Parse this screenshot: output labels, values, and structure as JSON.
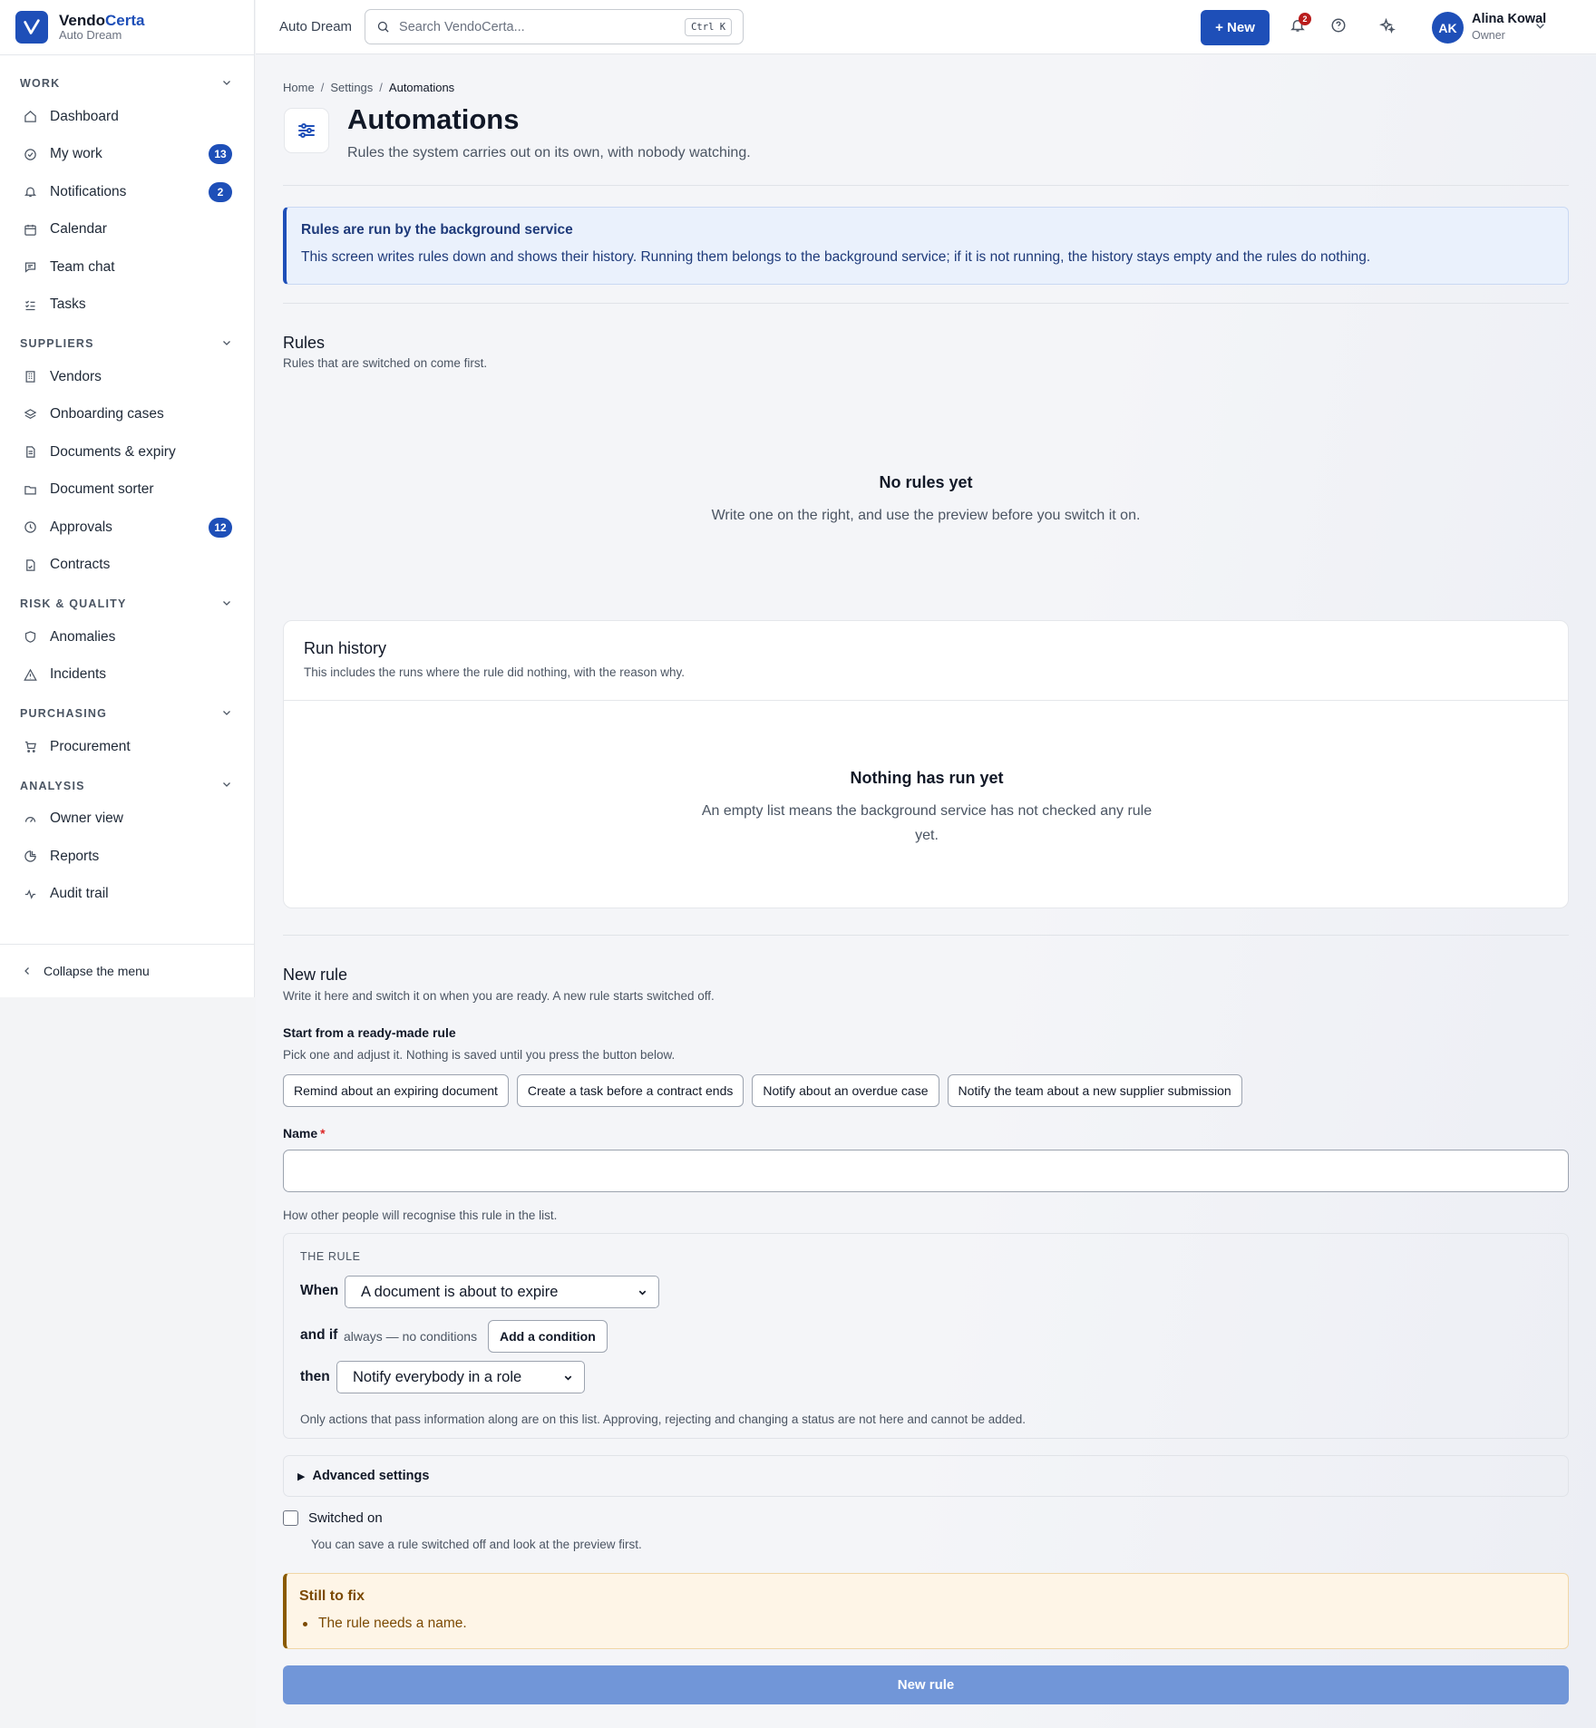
{
  "brand": {
    "name_a": "Vendo",
    "name_b": "Certa",
    "workspace": "Auto Dream"
  },
  "sidebar": {
    "sections": [
      {
        "title": "WORK",
        "items": [
          {
            "label": "Dashboard",
            "icon": "home-icon"
          },
          {
            "label": "My work",
            "icon": "check-circle-icon",
            "badge": "13"
          },
          {
            "label": "Notifications",
            "icon": "bell-icon",
            "badge": "2"
          },
          {
            "label": "Calendar",
            "icon": "calendar-icon"
          },
          {
            "label": "Team chat",
            "icon": "chat-icon"
          },
          {
            "label": "Tasks",
            "icon": "tasks-icon"
          }
        ]
      },
      {
        "title": "SUPPLIERS",
        "items": [
          {
            "label": "Vendors",
            "icon": "building-icon"
          },
          {
            "label": "Onboarding cases",
            "icon": "layers-icon"
          },
          {
            "label": "Documents & expiry",
            "icon": "document-icon"
          },
          {
            "label": "Document sorter",
            "icon": "folder-icon"
          },
          {
            "label": "Approvals",
            "icon": "clock-icon",
            "badge": "12"
          },
          {
            "label": "Contracts",
            "icon": "contract-icon"
          }
        ]
      },
      {
        "title": "RISK & QUALITY",
        "items": [
          {
            "label": "Anomalies",
            "icon": "shield-icon"
          },
          {
            "label": "Incidents",
            "icon": "warning-icon"
          }
        ]
      },
      {
        "title": "PURCHASING",
        "items": [
          {
            "label": "Procurement",
            "icon": "cart-icon"
          }
        ]
      },
      {
        "title": "ANALYSIS",
        "items": [
          {
            "label": "Owner view",
            "icon": "gauge-icon"
          },
          {
            "label": "Reports",
            "icon": "pie-chart-icon"
          },
          {
            "label": "Audit trail",
            "icon": "activity-icon"
          }
        ]
      }
    ],
    "collapse_label": "Collapse the menu"
  },
  "topbar": {
    "workspace": "Auto Dream",
    "search_placeholder": "Search VendoCerta...",
    "search_shortcut": "Ctrl K",
    "new_label": "+ New",
    "notification_count": "2",
    "avatar_initials": "AK",
    "user_name": "Alina Kowal",
    "user_role": "Owner"
  },
  "breadcrumb": [
    "Home",
    "Settings",
    "Automations"
  ],
  "page": {
    "title": "Automations",
    "subtitle": "Rules the system carries out on its own, with nobody watching."
  },
  "info": {
    "title": "Rules are run by the background service",
    "body": "This screen writes rules down and shows their history. Running them belongs to the background service; if it is not running, the history stays empty and the rules do nothing."
  },
  "rules": {
    "title": "Rules",
    "subtitle": "Rules that are switched on come first.",
    "empty_title": "No rules yet",
    "empty_body": "Write one on the right, and use the preview before you switch it on."
  },
  "history": {
    "title": "Run history",
    "subtitle": "This includes the runs where the rule did nothing, with the reason why.",
    "empty_title": "Nothing has run yet",
    "empty_body": "An empty list means the background service has not checked any rule yet."
  },
  "new_rule": {
    "title": "New rule",
    "subtitle": "Write it here and switch it on when you are ready. A new rule starts switched off.",
    "templates_title": "Start from a ready-made rule",
    "templates_help": "Pick one and adjust it. Nothing is saved until you press the button below.",
    "templates": [
      "Remind about an expiring document",
      "Create a task before a contract ends",
      "Notify about an overdue case",
      "Notify the team about a new supplier submission"
    ],
    "name_label": "Name",
    "name_required": "*",
    "name_value": "",
    "name_help": "How other people will recognise this rule in the list.",
    "rule_caption": "THE RULE",
    "when_label": "When",
    "when_value": "A document is about to expire",
    "andif_label": "and if",
    "andif_note": "always — no conditions",
    "add_condition": "Add a condition",
    "then_label": "then",
    "then_value": "Notify everybody in a role",
    "rule_note": "Only actions that pass information along are on this list. Approving, rejecting and changing a status are not here and cannot be added.",
    "advanced_label": "Advanced settings",
    "switch_label": "Switched on",
    "switch_checked": false,
    "switch_help": "You can save a rule switched off and look at the preview first.",
    "warn_title": "Still to fix",
    "warn_items": [
      "The rule needs a name."
    ],
    "submit_label": "New rule"
  },
  "colors": {
    "accent": "#1e4fb8",
    "alert": "#b91c1c",
    "warning": "#7c4a03",
    "submit_disabled": "#7196d8"
  }
}
